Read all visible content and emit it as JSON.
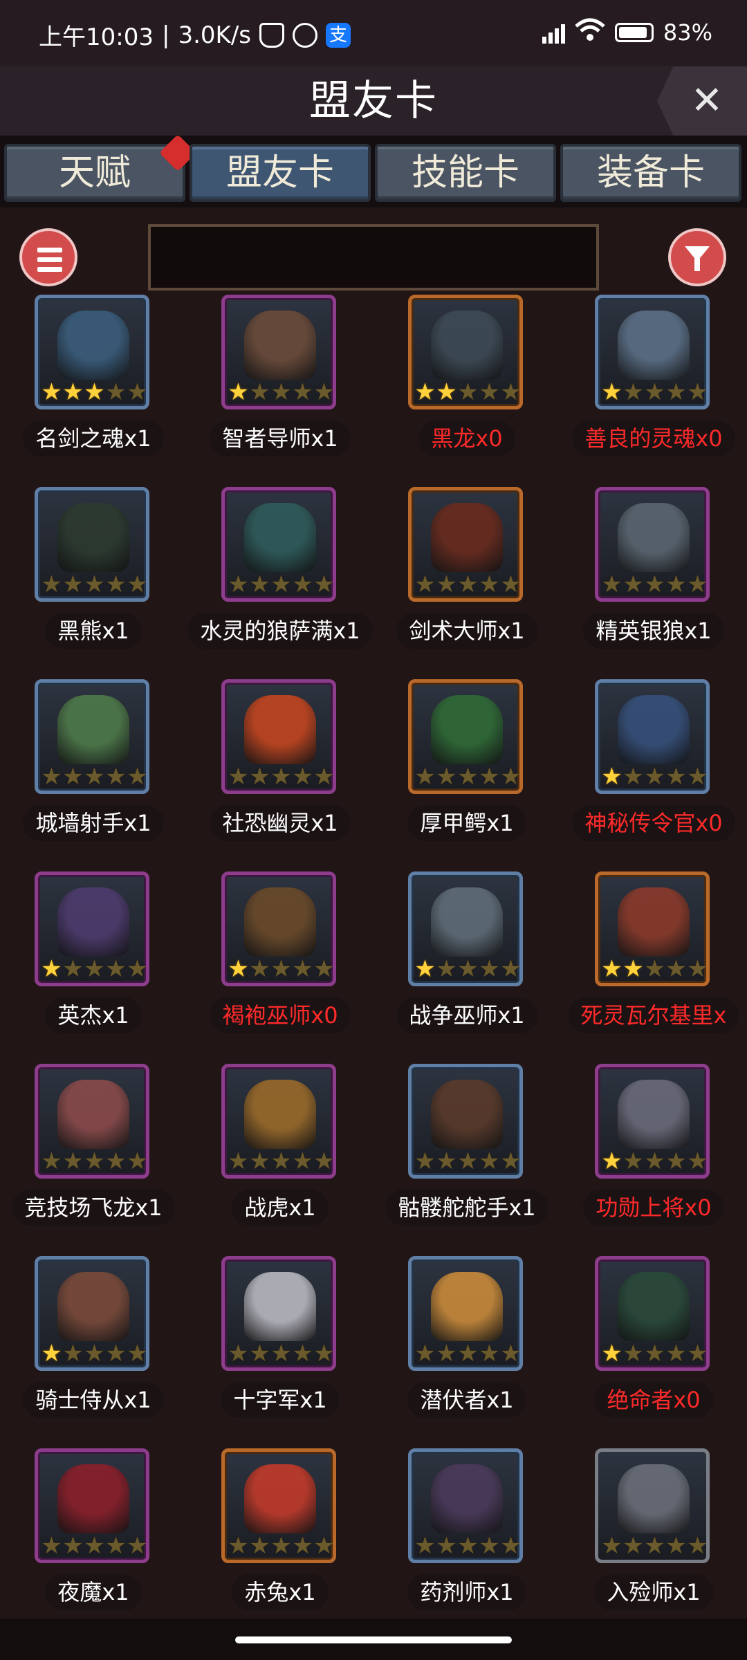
{
  "status": {
    "time": "上午10:03",
    "sep": "|",
    "speed": "3.0K/s",
    "alipay": "支",
    "battery": "83%"
  },
  "header": {
    "title": "盟友卡",
    "close_label": "✕"
  },
  "tabs": [
    {
      "label": "天赋",
      "badge": true
    },
    {
      "label": "盟友卡",
      "active": true
    },
    {
      "label": "技能卡"
    },
    {
      "label": "装备卡"
    }
  ],
  "search": {
    "placeholder": ""
  },
  "cards": [
    {
      "name": "名剑之魂x1",
      "stars": 3,
      "rarity": "blue",
      "color": "#3a5d7c",
      "missing": false
    },
    {
      "name": "智者导师x1",
      "stars": 1,
      "rarity": "purple",
      "color": "#6b4b3a",
      "missing": false
    },
    {
      "name": "黑龙x0",
      "stars": 2,
      "rarity": "orange",
      "color": "#3d4a55",
      "missing": true
    },
    {
      "name": "善良的灵魂x0",
      "stars": 1,
      "rarity": "blue",
      "color": "#5b6f86",
      "missing": true
    },
    {
      "name": "黑熊x1",
      "stars": 0,
      "rarity": "blue",
      "color": "#2c3a2f",
      "missing": false
    },
    {
      "name": "水灵的狼萨满x1",
      "stars": 0,
      "rarity": "purple",
      "color": "#2f5b5a",
      "missing": false
    },
    {
      "name": "剑术大师x1",
      "stars": 0,
      "rarity": "orange",
      "color": "#6a2b1e",
      "missing": false
    },
    {
      "name": "精英银狼x1",
      "stars": 0,
      "rarity": "purple",
      "color": "#5a6570",
      "missing": false
    },
    {
      "name": "城墙射手x1",
      "stars": 0,
      "rarity": "blue",
      "color": "#4e7a4a",
      "missing": false
    },
    {
      "name": "社恐幽灵x1",
      "stars": 0,
      "rarity": "purple",
      "color": "#c2451f",
      "missing": false
    },
    {
      "name": "厚甲鳄x1",
      "stars": 0,
      "rarity": "orange",
      "color": "#2f6a36",
      "missing": false
    },
    {
      "name": "神秘传令官x0",
      "stars": 1,
      "rarity": "blue",
      "color": "#36507a",
      "missing": true
    },
    {
      "name": "英杰x1",
      "stars": 1,
      "rarity": "purple",
      "color": "#4d3b6e",
      "missing": false
    },
    {
      "name": "褐袍巫师x0",
      "stars": 1,
      "rarity": "purple",
      "color": "#6b4a2a",
      "missing": true
    },
    {
      "name": "战争巫师x1",
      "stars": 1,
      "rarity": "blue",
      "color": "#5f6d78",
      "missing": false
    },
    {
      "name": "死灵瓦尔基里x",
      "stars": 2,
      "rarity": "orange",
      "color": "#8a3a2a",
      "missing": true
    },
    {
      "name": "竞技场飞龙x1",
      "stars": 0,
      "rarity": "purple",
      "color": "#8a4a4a",
      "missing": false
    },
    {
      "name": "战虎x1",
      "stars": 0,
      "rarity": "purple",
      "color": "#9a6a2a",
      "missing": false
    },
    {
      "name": "骷髅舵舵手x1",
      "stars": 0,
      "rarity": "blue",
      "color": "#5a3a2a",
      "missing": false
    },
    {
      "name": "功勋上将x0",
      "stars": 1,
      "rarity": "purple",
      "color": "#6a6a7a",
      "missing": true
    },
    {
      "name": "骑士侍从x1",
      "stars": 1,
      "rarity": "blue",
      "color": "#7a4a3a",
      "missing": false
    },
    {
      "name": "十字军x1",
      "stars": 0,
      "rarity": "purple",
      "color": "#b8b8c0",
      "missing": false
    },
    {
      "name": "潜伏者x1",
      "stars": 0,
      "rarity": "blue",
      "color": "#c98a3a",
      "missing": false
    },
    {
      "name": "绝命者x0",
      "stars": 1,
      "rarity": "purple",
      "color": "#2a4a3a",
      "missing": true
    },
    {
      "name": "夜魔x1",
      "stars": 0,
      "rarity": "purple",
      "color": "#8a1f2a",
      "missing": false
    },
    {
      "name": "赤兔x1",
      "stars": 0,
      "rarity": "orange",
      "color": "#c23a2a",
      "missing": false
    },
    {
      "name": "药剂师x1",
      "stars": 0,
      "rarity": "blue",
      "color": "#4a3a5a",
      "missing": false
    },
    {
      "name": "入殓师x1",
      "stars": 0,
      "rarity": "gray",
      "color": "#6a6e78",
      "missing": false
    }
  ]
}
